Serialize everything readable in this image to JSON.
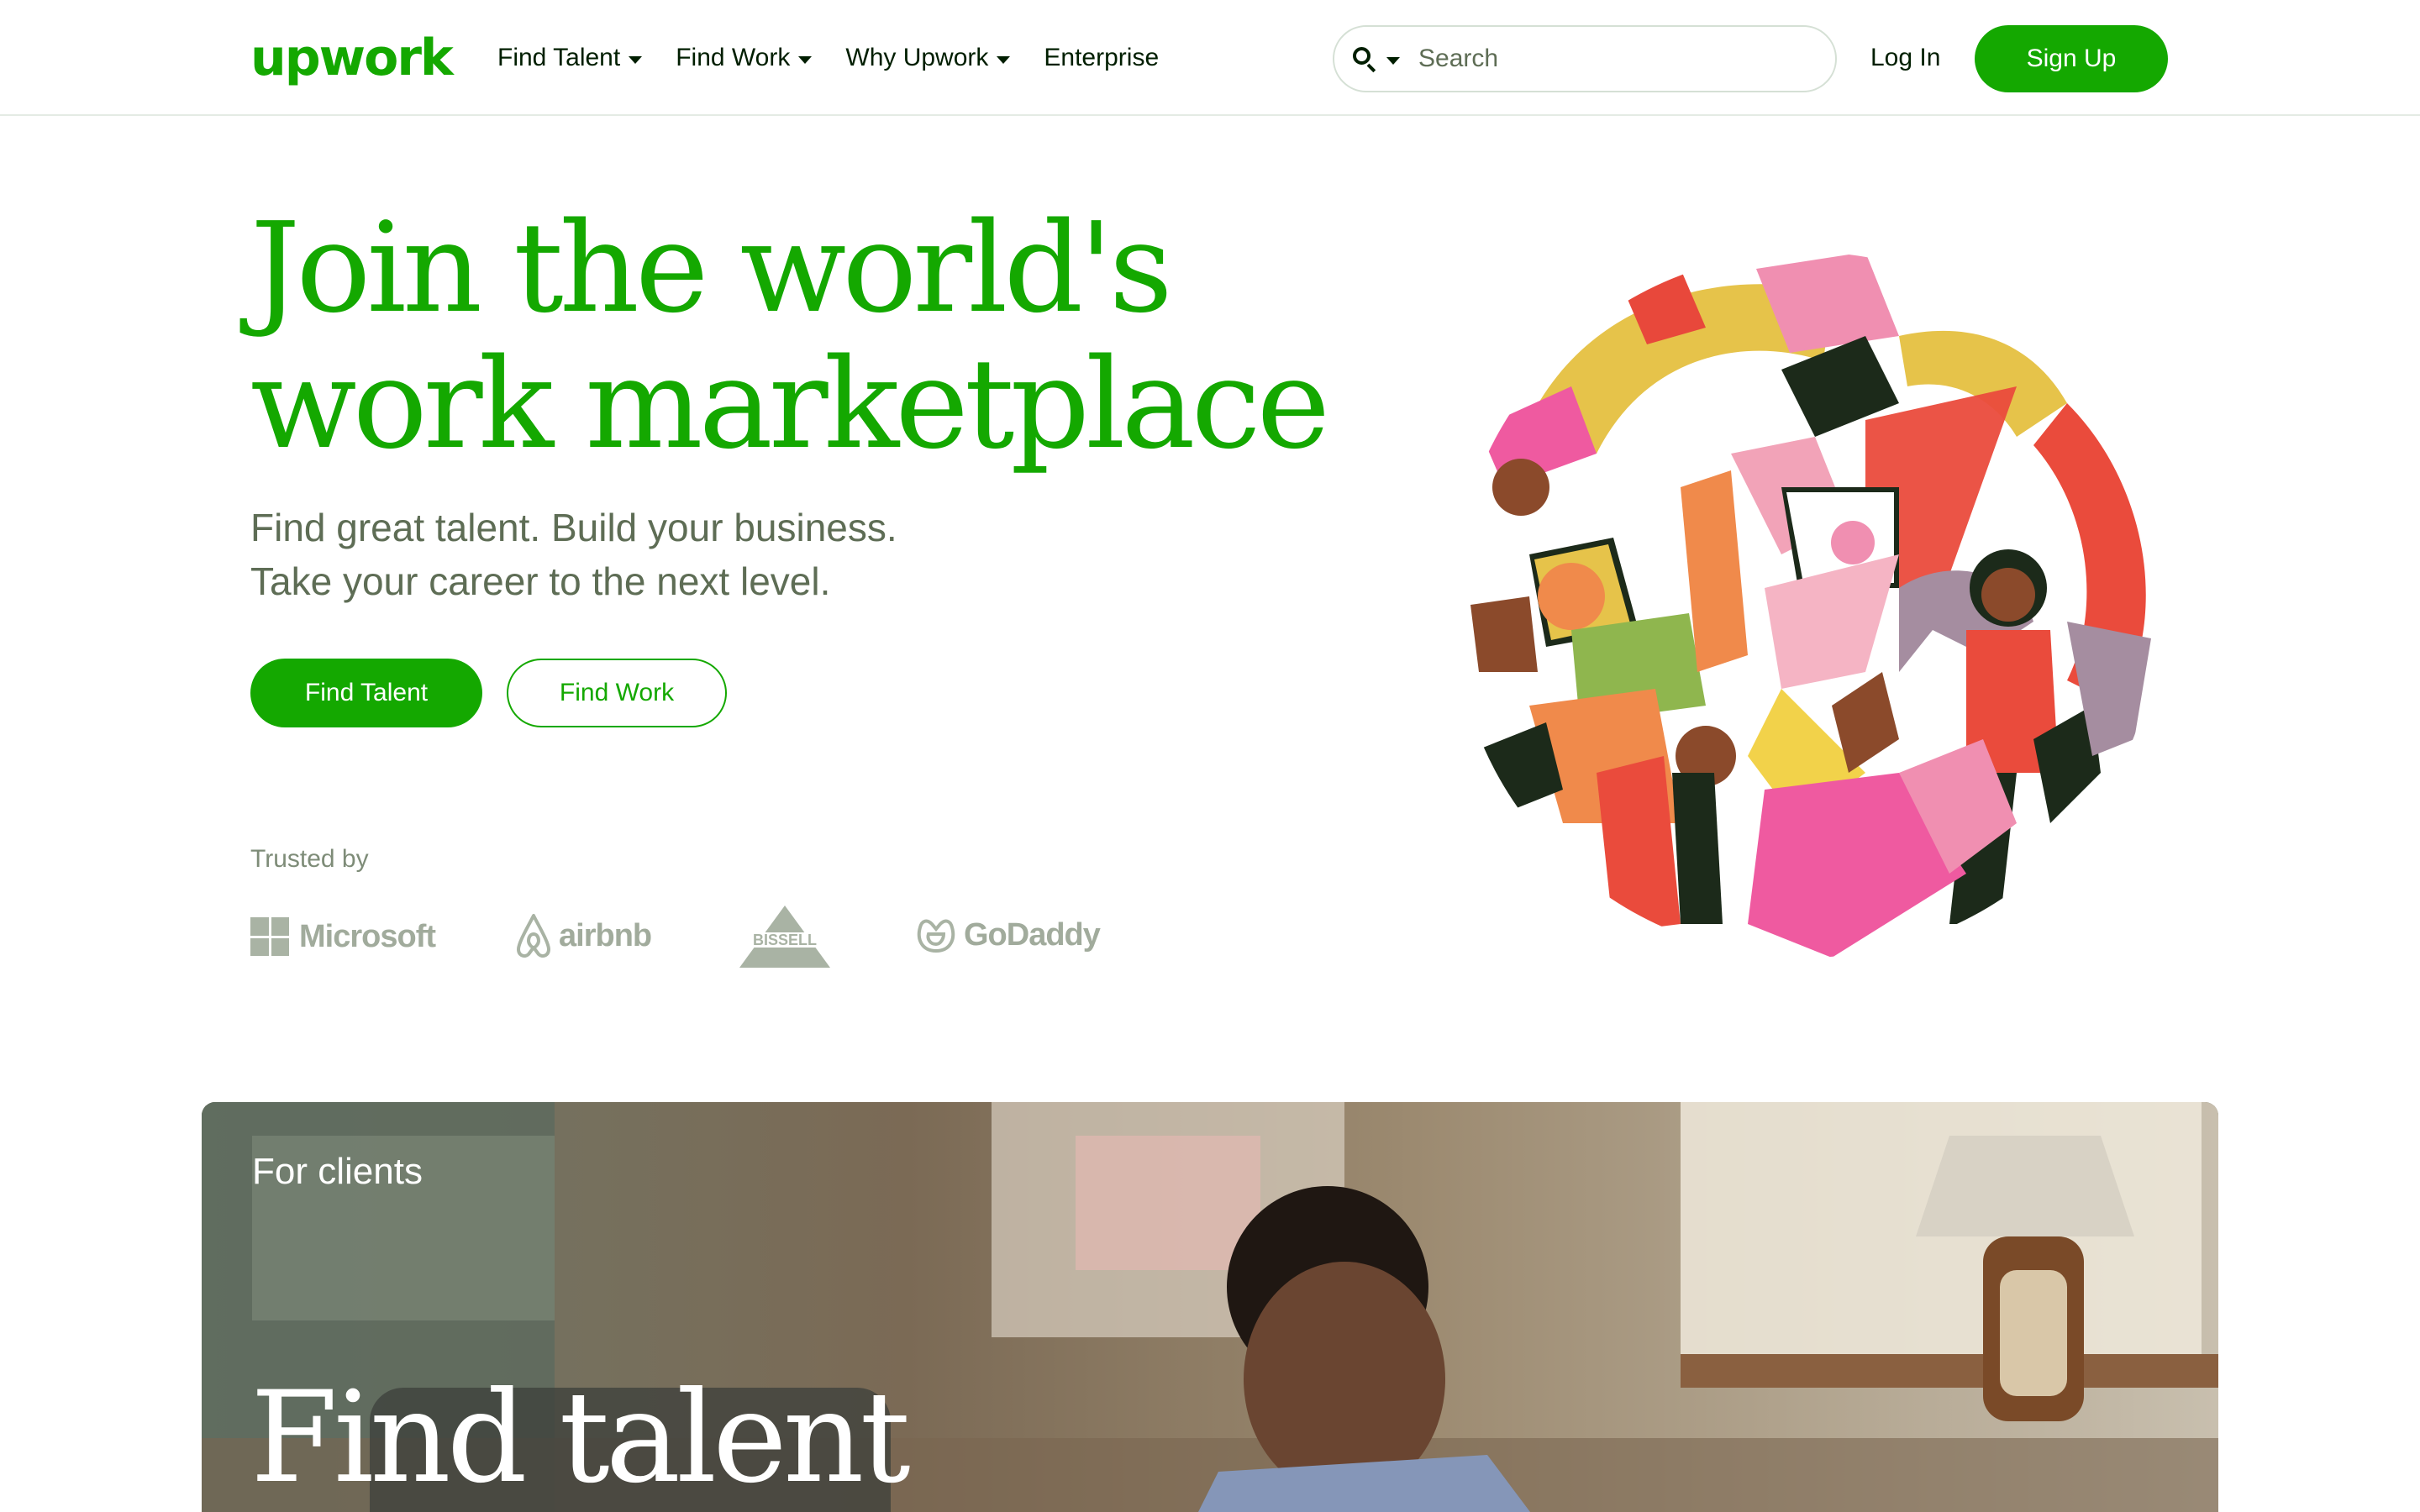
{
  "header": {
    "logo": "upwork",
    "nav": [
      {
        "label": "Find Talent",
        "has_dropdown": true
      },
      {
        "label": "Find Work",
        "has_dropdown": true
      },
      {
        "label": "Why Upwork",
        "has_dropdown": true
      },
      {
        "label": "Enterprise",
        "has_dropdown": false
      }
    ],
    "search": {
      "placeholder": "Search",
      "value": ""
    },
    "login_label": "Log In",
    "signup_label": "Sign Up"
  },
  "hero": {
    "title_line1": "Join the world's",
    "title_line2": "work marketplace",
    "subtitle_line1": "Find great talent. Build your business.",
    "subtitle_line2": "Take your career to the next level.",
    "primary_cta": "Find Talent",
    "secondary_cta": "Find Work",
    "trusted_label": "Trusted by",
    "trusted_logos": [
      "Microsoft",
      "airbnb",
      "BISSELL",
      "GoDaddy"
    ]
  },
  "clients_section": {
    "label": "For clients",
    "title": "Find talent"
  },
  "colors": {
    "brand_green": "#14a800",
    "text_dark": "#001e00",
    "text_muted": "#5e6d55",
    "logo_gray": "#a1ab9c"
  },
  "icons": [
    "search-icon",
    "chevron-down-icon"
  ]
}
